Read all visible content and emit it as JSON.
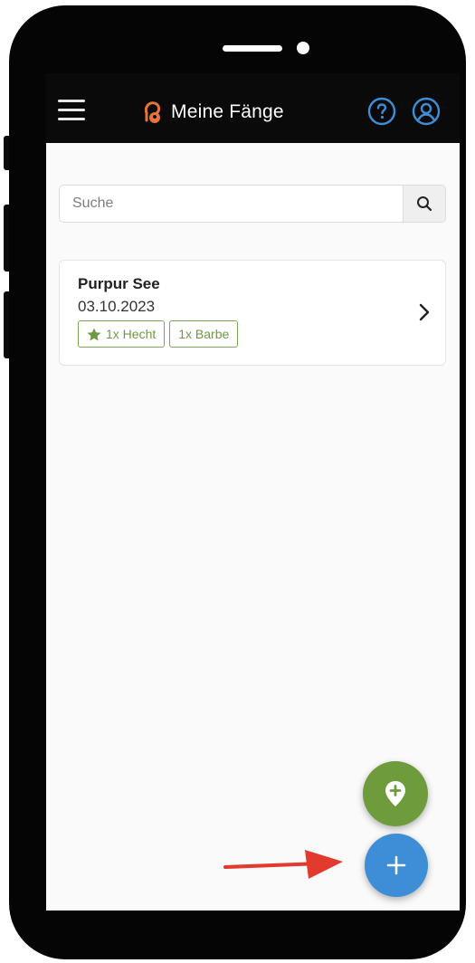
{
  "header": {
    "title": "Meine Fänge",
    "menu_icon": "hamburger-icon",
    "help_icon": "question-circle-icon",
    "user_icon": "user-circle-icon"
  },
  "search": {
    "placeholder": "Suche",
    "button_icon": "search-icon"
  },
  "catches": [
    {
      "title": "Purpur See",
      "date": "03.10.2023",
      "tags": [
        {
          "label": "1x Hecht",
          "starred": true
        },
        {
          "label": "1x Barbe",
          "starred": false
        }
      ]
    }
  ],
  "fabs": {
    "location": {
      "icon": "map-marker-plus-icon",
      "color": "#6e9c3d"
    },
    "add": {
      "icon": "plus-icon",
      "color": "#3d8ed7"
    }
  },
  "colors": {
    "header_bg": "#0a0a0a",
    "accent_orange": "#e8733a",
    "help_blue": "#3d8ed7",
    "tag_green": "#6f9a45",
    "annotation_red": "#e23a2e"
  }
}
